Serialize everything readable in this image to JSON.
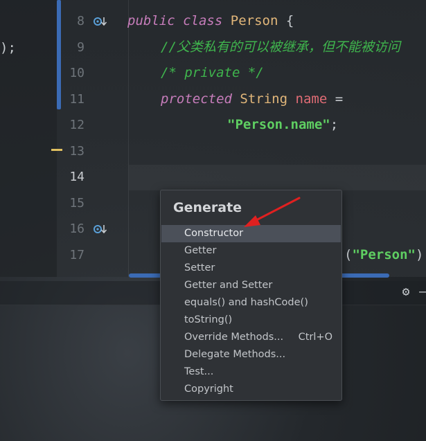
{
  "editor": {
    "left_fragment": ");",
    "line_numbers": [
      "8",
      "9",
      "10",
      "11",
      "12",
      "13",
      "14",
      "15",
      "16",
      "17"
    ],
    "active_line": "14",
    "code": {
      "l8": {
        "public": "public",
        "class": "class",
        "name": "Person",
        "brace": " {"
      },
      "l9": {
        "comment": "//父类私有的可以被继承，但不能被访问"
      },
      "l10": {
        "comment": "/* private */"
      },
      "l11": {
        "protected": "protected",
        "type": "String",
        "field": "name",
        "eq": " ="
      },
      "l12": {
        "value": "\"Person.name\"",
        "semi": ";"
      },
      "l17": {
        "open": "(",
        "arg": "\"Person\"",
        "close": ")"
      }
    }
  },
  "popup": {
    "title": "Generate",
    "items": [
      {
        "label": "Constructor",
        "shortcut": ""
      },
      {
        "label": "Getter",
        "shortcut": ""
      },
      {
        "label": "Setter",
        "shortcut": ""
      },
      {
        "label": "Getter and Setter",
        "shortcut": ""
      },
      {
        "label": "equals() and hashCode()",
        "shortcut": ""
      },
      {
        "label": "toString()",
        "shortcut": ""
      },
      {
        "label": "Override Methods...",
        "shortcut": "Ctrl+O"
      },
      {
        "label": "Delegate Methods...",
        "shortcut": ""
      },
      {
        "label": "Test...",
        "shortcut": ""
      },
      {
        "label": "Copyright",
        "shortcut": ""
      }
    ],
    "selected_index": 0
  },
  "colors": {
    "keyword": "#c77dbb",
    "class_name": "#e2b77a",
    "comment": "#3fb54d",
    "field": "#e06c75",
    "string": "#5fcf62",
    "selection": "#4b5059",
    "arrow": "#e02020",
    "accent_blue": "#3b6bb5"
  },
  "icons": {
    "gutter_override": "override-arrow-icon",
    "settings": "gear-icon"
  }
}
